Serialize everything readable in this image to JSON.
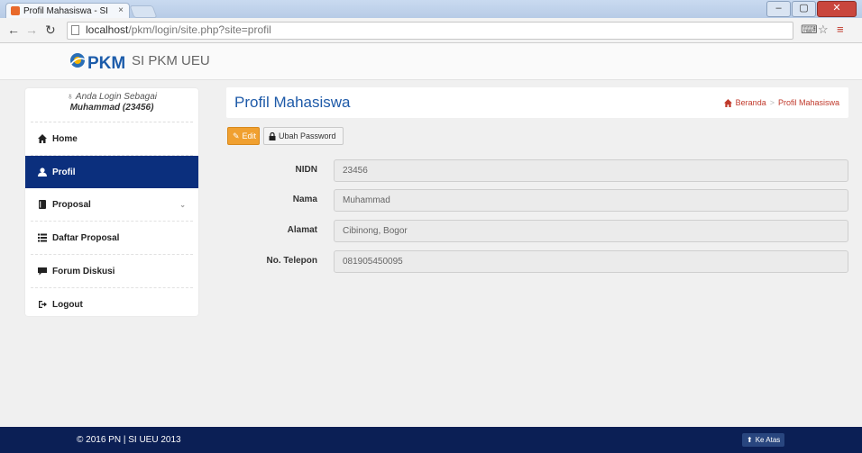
{
  "browser": {
    "tab_title": "Profil Mahasiswa - SI PKM",
    "tab_close": "×",
    "url_host": "localhost",
    "url_path": "/pkm/login/site.php?site=profil"
  },
  "header": {
    "logo_text": "PKM",
    "brand": "SI PKM UEU"
  },
  "sidebar": {
    "login_label": "Anda Login Sebagai",
    "login_user": "Muhammad (23456)",
    "items": [
      {
        "label": "Home",
        "icon": "home-icon"
      },
      {
        "label": "Profil",
        "icon": "user-icon"
      },
      {
        "label": "Proposal",
        "icon": "book-icon"
      },
      {
        "label": "Daftar Proposal",
        "icon": "list-icon"
      },
      {
        "label": "Forum Diskusi",
        "icon": "comment-icon"
      },
      {
        "label": "Logout",
        "icon": "logout-icon"
      }
    ]
  },
  "main": {
    "title": "Profil Mahasiswa",
    "breadcrumb": [
      "Beranda",
      "Profil Mahasiswa"
    ],
    "buttons": {
      "edit": "Edit",
      "change_password": "Ubah Password"
    },
    "fields": [
      {
        "label": "NIDN",
        "value": "23456"
      },
      {
        "label": "Nama",
        "value": "Muhammad"
      },
      {
        "label": "Alamat",
        "value": "Cibinong, Bogor"
      },
      {
        "label": "No. Telepon",
        "value": "081905450095"
      }
    ]
  },
  "footer": {
    "copyright": "© 2016 PN | SI UEU 2013",
    "back_to_top": "Ke Atas"
  },
  "colors": {
    "primary": "#0b2f7d",
    "footer": "#0b1f55",
    "edit_button": "#f0a030",
    "title": "#1e5aa8",
    "breadcrumb": "#c0392b"
  }
}
